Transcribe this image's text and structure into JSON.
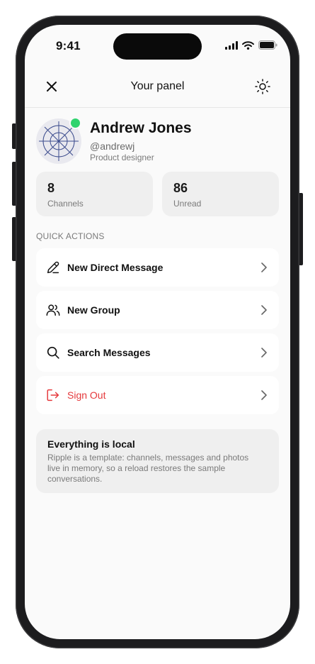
{
  "status_bar": {
    "time": "9:41",
    "icons": [
      "cellular-signal-icon",
      "wifi-icon",
      "battery-icon"
    ]
  },
  "header": {
    "title": "Your panel",
    "close_icon": "close-icon",
    "theme_icon": "sun-icon"
  },
  "profile": {
    "name": "Andrew Jones",
    "handle": "@andrewj",
    "role": "Product designer",
    "online_color": "#2fd36e"
  },
  "stats": [
    {
      "value": "8",
      "label": "Channels"
    },
    {
      "value": "86",
      "label": "Unread"
    }
  ],
  "quick_actions": {
    "label": "QUICK ACTIONS",
    "items": [
      {
        "label": "New Direct Message",
        "icon": "pencil-icon"
      },
      {
        "label": "New Group",
        "icon": "users-icon"
      },
      {
        "label": "Search Messages",
        "icon": "search-icon"
      },
      {
        "label": "Sign Out",
        "icon": "sign-out-icon",
        "color": "#e5383b"
      }
    ]
  },
  "info": {
    "title": "Everything is local",
    "body": "Ripple is a template: channels, messages and photos live in memory, so a reload restores the sample conversations."
  }
}
